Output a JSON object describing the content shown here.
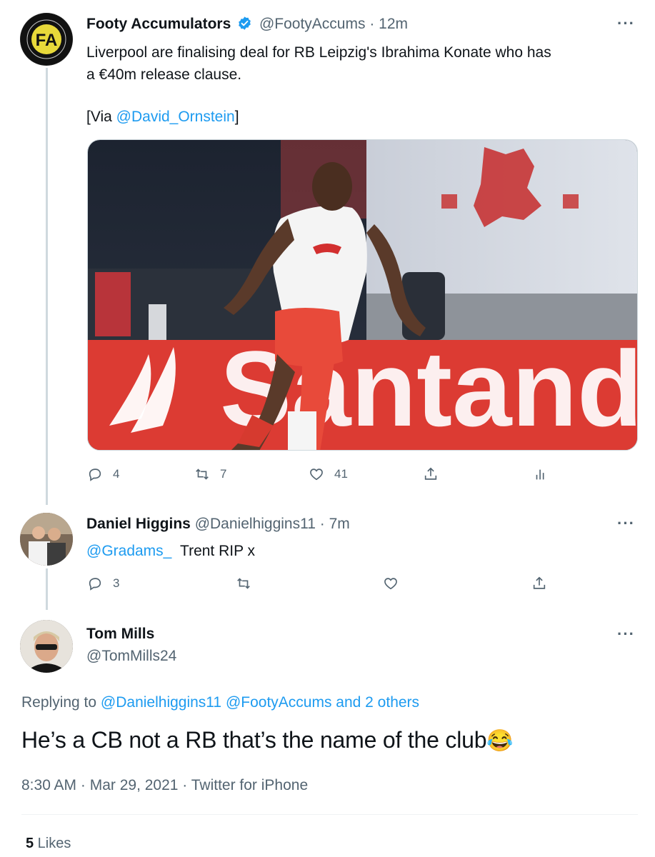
{
  "tweet1": {
    "name": "Footy Accumulators",
    "handle": "@FootyAccums",
    "sep": "·",
    "time": "12m",
    "text_line1": "Liverpool are finalising deal for RB Leipzig's Ibrahima Konate who has",
    "text_line2": "a €40m release clause.",
    "via_prefix": "[Via ",
    "via_mention": "@David_Ornstein",
    "via_suffix": "]",
    "image_banner_text": "Santand",
    "actions": {
      "replies": "4",
      "retweets": "7",
      "likes": "41"
    }
  },
  "tweet2": {
    "name": "Daniel Higgins",
    "handle": "@Danielhiggins11",
    "sep": "·",
    "time": "7m",
    "mention": "@Gradams_",
    "text": "Trent RIP x",
    "actions": {
      "replies": "3"
    }
  },
  "tweet3": {
    "name": "Tom Mills",
    "handle": "@TomMills24",
    "replying_prefix": "Replying to ",
    "replying_mentions": "@Danielhiggins11 @FootyAccums and 2 others",
    "text": "He’s a CB not a RB that’s the name of the club",
    "emoji": "😂",
    "timestamp": "8:30 AM · Mar 29, 2021 · Twitter for iPhone",
    "likes_count": "5",
    "likes_label": " Likes"
  },
  "icons": {
    "more": "more-icon",
    "verified": "verified-badge-icon",
    "reply": "reply-icon",
    "retweet": "retweet-icon",
    "like": "heart-icon",
    "share": "share-icon",
    "analytics": "analytics-icon"
  },
  "colors": {
    "accent": "#1d9bf0",
    "text": "#0f1419",
    "secondary": "#536471"
  }
}
